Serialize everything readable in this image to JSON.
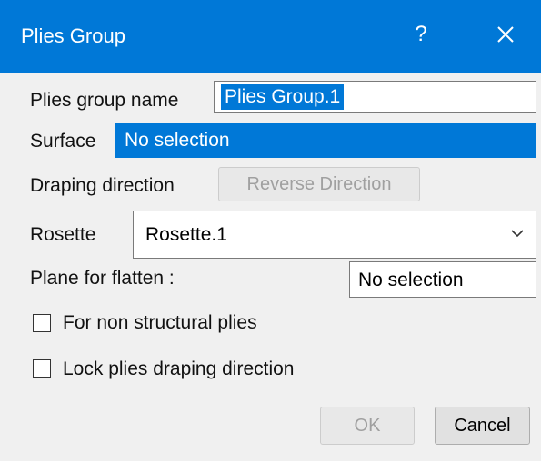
{
  "window": {
    "title": "Plies Group",
    "help_label": "?"
  },
  "form": {
    "group_name_label": "Plies group name",
    "group_name_value": "Plies Group.1",
    "surface_label": "Surface",
    "surface_value": "No selection",
    "draping_label": "Draping direction",
    "reverse_button": "Reverse Direction",
    "rosette_label": "Rosette",
    "rosette_value": "Rosette.1",
    "plane_label": "Plane for flatten :",
    "plane_value": "No selection",
    "non_structural_label": "For non structural plies",
    "non_structural_checked": false,
    "lock_label": "Lock plies draping direction",
    "lock_checked": false
  },
  "buttons": {
    "ok": "OK",
    "cancel": "Cancel"
  },
  "colors": {
    "titlebar": "#0078d7",
    "selection": "#0078d7",
    "dialog_bg": "#f0f0f0"
  }
}
